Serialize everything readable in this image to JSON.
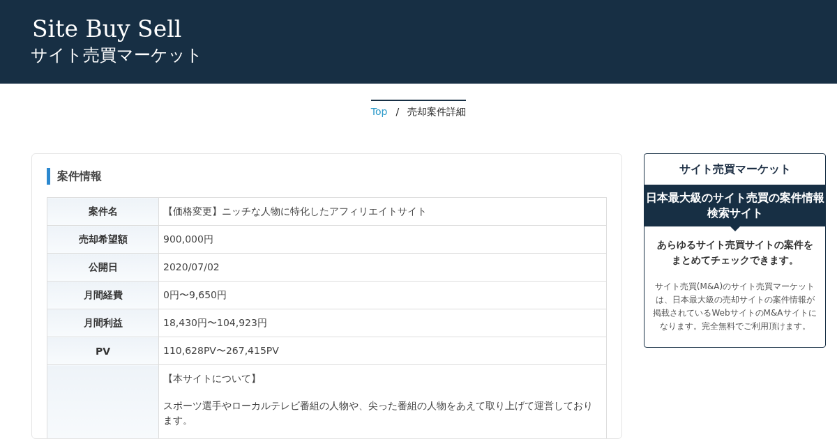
{
  "header": {
    "title": "Site Buy Sell",
    "subtitle": "サイト売買マーケット"
  },
  "breadcrumb": [
    {
      "label": "Top",
      "kind": "link"
    },
    {
      "label": "/",
      "kind": "separator"
    },
    {
      "label": "売却案件詳細",
      "kind": "current"
    }
  ],
  "section": {
    "heading": "案件情報",
    "rows": [
      {
        "label": "案件名",
        "value": [
          "【価格変更】ニッチな人物に特化したアフィリエイトサイト"
        ]
      },
      {
        "label": "売却希望額",
        "value": [
          "900,000円"
        ]
      },
      {
        "label": "公開日",
        "value": [
          "2020/07/02"
        ]
      },
      {
        "label": "月間経費",
        "value": [
          "0円〜9,650円"
        ]
      },
      {
        "label": "月間利益",
        "value": [
          "18,430円〜104,923円"
        ]
      },
      {
        "label": "PV",
        "value": [
          "110,628PV〜267,415PV"
        ]
      },
      {
        "value": [
          "【本サイトについて】",
          "スポーツ選手やローカルテレビ番組の人物や、尖った番組の人物をあえて取り上げて運営しております。"
        ]
      }
    ]
  },
  "sidebar": {
    "title": "サイト売買マーケット",
    "banner": "日本最大級のサイト売買の案件情報検索サイト",
    "lead": "あらゆるサイト売買サイトの案件をまとめてチェックできます。",
    "body": "サイト売買(M&A)のサイト売買マーケットは、日本最大級の売却サイトの案件情報が掲載されているWebサイトのM&Aサイトになります。完全無料でご利用頂けます。"
  }
}
